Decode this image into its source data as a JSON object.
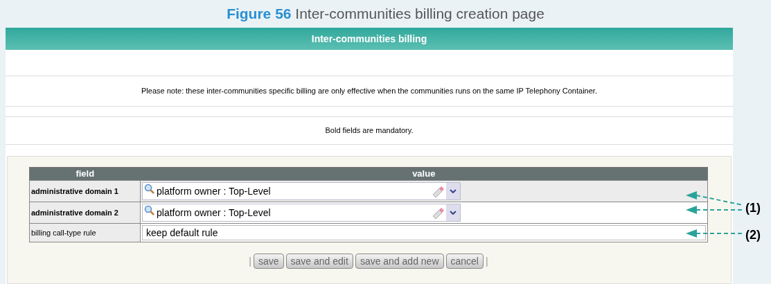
{
  "caption": {
    "number": "Figure 56",
    "title": "Inter-communities billing creation page"
  },
  "panel_title": "Inter-communities billing",
  "notes": [
    "Please note: these inter-communities specific billing are only effective when the communities runs on the same IP Telephony Container.",
    "Bold fields are mandatory."
  ],
  "table": {
    "columns": [
      "field",
      "value"
    ],
    "rows": [
      {
        "label": "administrative domain 1",
        "mandatory": true,
        "shaded": true,
        "kind": "lookup",
        "value": "platform owner : Top-Level",
        "callout": "(1)"
      },
      {
        "label": "administrative domain 2",
        "mandatory": true,
        "shaded": false,
        "kind": "lookup",
        "value": "platform owner : Top-Level",
        "callout": ""
      },
      {
        "label": "billing call-type rule",
        "mandatory": false,
        "shaded": false,
        "kind": "text",
        "value": "keep default rule",
        "callout": "(2)"
      }
    ]
  },
  "separators": [
    "|",
    "|"
  ],
  "buttons": [
    "save",
    "save and edit",
    "save and add new",
    "cancel"
  ]
}
